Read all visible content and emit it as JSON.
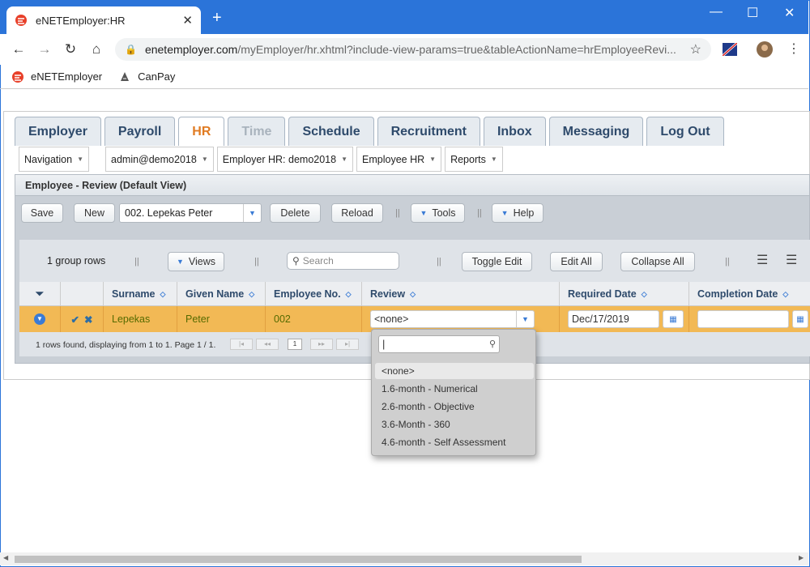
{
  "browser": {
    "tab_title": "eNETEmployer:HR",
    "url_domain": "enetemployer.com",
    "url_path": "/myEmployer/hr.xhtml?include-view-params=true&tableActionName=hrEmployeeRevi...",
    "bookmarks": [
      "eNETEmployer",
      "CanPay"
    ]
  },
  "main_tabs": [
    "Employer",
    "Payroll",
    "HR",
    "Time",
    "Schedule",
    "Recruitment",
    "Inbox",
    "Messaging",
    "Log Out"
  ],
  "subnav": [
    "Navigation",
    "admin@demo2018",
    "Employer HR: demo2018",
    "Employee HR",
    "Reports"
  ],
  "panel_title": "Employee - Review (Default View)",
  "toolbar": {
    "save": "Save",
    "new": "New",
    "employee_select": "002. Lepekas Peter",
    "delete": "Delete",
    "reload": "Reload",
    "tools": "Tools",
    "help": "Help"
  },
  "gridbar": {
    "group_rows": "1 group rows",
    "views": "Views",
    "search_placeholder": "Search",
    "toggle_edit": "Toggle Edit",
    "edit_all": "Edit All",
    "collapse_all": "Collapse All"
  },
  "columns": [
    "Surname",
    "Given Name",
    "Employee No.",
    "Review",
    "Required Date",
    "Completion Date"
  ],
  "row": {
    "surname": "Lepekas",
    "given_name": "Peter",
    "employee_no": "002",
    "review": "<none>",
    "required_date": "Dec/17/2019",
    "completion_date": ""
  },
  "footer_text": "1 rows found, displaying from 1 to 1. Page 1 / 1.",
  "page_number": "1",
  "review_options": [
    "<none>",
    "1.6-month - Numerical",
    "2.6-month - Objective",
    "3.6-Month - 360",
    "4.6-month - Self Assessment"
  ]
}
